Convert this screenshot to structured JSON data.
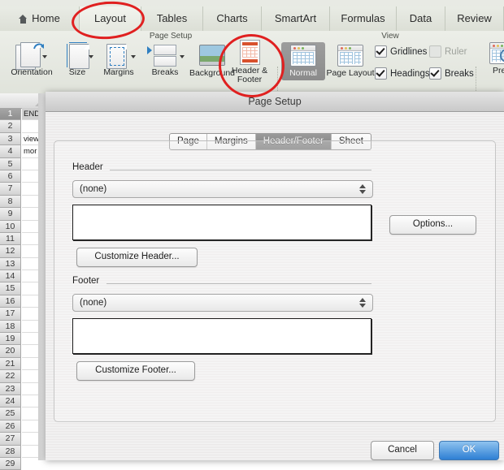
{
  "ribbon": {
    "tabs": [
      {
        "label": "Home",
        "icon": "home-icon"
      },
      {
        "label": "Layout",
        "icon": ""
      },
      {
        "label": "Tables",
        "icon": ""
      },
      {
        "label": "Charts",
        "icon": ""
      },
      {
        "label": "SmartArt",
        "icon": ""
      },
      {
        "label": "Formulas",
        "icon": ""
      },
      {
        "label": "Data",
        "icon": ""
      },
      {
        "label": "Review",
        "icon": ""
      }
    ],
    "groups": [
      {
        "name": "Page Setup"
      },
      {
        "name": "View"
      }
    ],
    "page_setup": [
      {
        "label": "Orientation",
        "icon": "orientation-icon"
      },
      {
        "label": "Size",
        "icon": "size-icon"
      },
      {
        "label": "Margins",
        "icon": "margins-icon"
      },
      {
        "label": "Breaks",
        "icon": "breaks-icon"
      },
      {
        "label": "Background",
        "icon": "background-icon"
      },
      {
        "label_line1": "Header &",
        "label_line2": "Footer",
        "icon": "header-footer-icon"
      }
    ],
    "view": {
      "normal": "Normal",
      "page_layout": "Page Layout",
      "preview": "Previ",
      "checks": [
        {
          "label": "Gridlines",
          "checked": true,
          "disabled": false
        },
        {
          "label": "Ruler",
          "checked": false,
          "disabled": true
        },
        {
          "label": "Headings",
          "checked": true,
          "disabled": false
        },
        {
          "label": "Breaks",
          "checked": true,
          "disabled": false
        }
      ]
    }
  },
  "sheet": {
    "rows": [
      {
        "n": "1",
        "text": "END",
        "selected": true
      },
      {
        "n": "2",
        "text": "",
        "selected": false
      },
      {
        "n": "3",
        "text": "view",
        "selected": false
      },
      {
        "n": "4",
        "text": "mor",
        "selected": false
      },
      {
        "n": "5",
        "text": "",
        "selected": false
      },
      {
        "n": "6",
        "text": "",
        "selected": false
      },
      {
        "n": "7",
        "text": "",
        "selected": false
      },
      {
        "n": "8",
        "text": "",
        "selected": false
      },
      {
        "n": "9",
        "text": "",
        "selected": false
      },
      {
        "n": "10",
        "text": "",
        "selected": false
      },
      {
        "n": "11",
        "text": "",
        "selected": false
      },
      {
        "n": "12",
        "text": "",
        "selected": false
      },
      {
        "n": "13",
        "text": "",
        "selected": false
      },
      {
        "n": "14",
        "text": "",
        "selected": false
      },
      {
        "n": "15",
        "text": "",
        "selected": false
      },
      {
        "n": "16",
        "text": "",
        "selected": false
      },
      {
        "n": "17",
        "text": "",
        "selected": false
      },
      {
        "n": "18",
        "text": "",
        "selected": false
      },
      {
        "n": "19",
        "text": "",
        "selected": false
      },
      {
        "n": "20",
        "text": "",
        "selected": false
      },
      {
        "n": "21",
        "text": "",
        "selected": false
      },
      {
        "n": "22",
        "text": "",
        "selected": false
      },
      {
        "n": "23",
        "text": "",
        "selected": false
      },
      {
        "n": "24",
        "text": "",
        "selected": false
      },
      {
        "n": "25",
        "text": "",
        "selected": false
      },
      {
        "n": "26",
        "text": "",
        "selected": false
      },
      {
        "n": "27",
        "text": "",
        "selected": false
      },
      {
        "n": "28",
        "text": "",
        "selected": false
      },
      {
        "n": "29",
        "text": "",
        "selected": false
      }
    ]
  },
  "dialog": {
    "title": "Page Setup",
    "tabs": [
      {
        "label": "Page",
        "active": false
      },
      {
        "label": "Margins",
        "active": false
      },
      {
        "label": "Header/Footer",
        "active": true
      },
      {
        "label": "Sheet",
        "active": false
      }
    ],
    "header_section": {
      "label": "Header",
      "dropdown_value": "(none)",
      "preview_text": "",
      "customize_label": "Customize Header..."
    },
    "footer_section": {
      "label": "Footer",
      "dropdown_value": "(none)",
      "preview_text": "",
      "customize_label": "Customize Footer..."
    },
    "options_label": "Options...",
    "cancel_label": "Cancel",
    "ok_label": "OK"
  },
  "annotations": {
    "accent_color": "#e02020",
    "rings": [
      {
        "target": "Layout tab"
      },
      {
        "target": "Header & Footer button"
      }
    ]
  }
}
